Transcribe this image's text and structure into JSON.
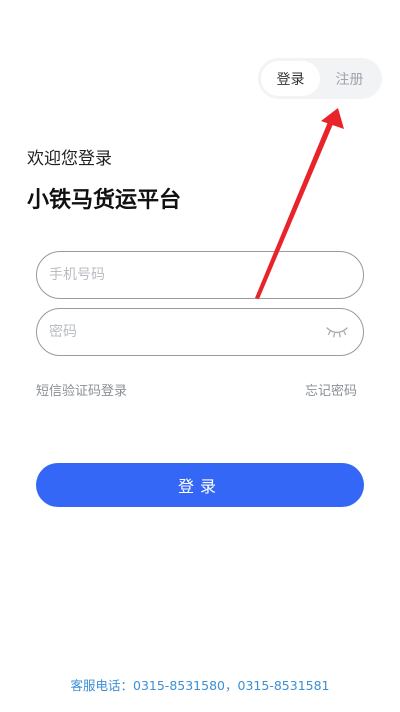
{
  "auth_toggle": {
    "login_label": "登录",
    "register_label": "注册"
  },
  "header": {
    "welcome": "欢迎您登录",
    "brand": "小铁马货运平台"
  },
  "form": {
    "phone_placeholder": "手机号码",
    "password_placeholder": "密码",
    "sms_login_link": "短信验证码登录",
    "forgot_password_link": "忘记密码",
    "submit_label": "登录"
  },
  "footer": {
    "service_label": "客服电话：",
    "phone_1": "0315-8531580",
    "separator": "，",
    "phone_2": "0315-8531581"
  },
  "colors": {
    "primary": "#3567f6",
    "annotation_arrow": "#e8232a",
    "service_text": "#3a8fd8"
  },
  "icons": {
    "password_visibility": "eye-closed-icon"
  }
}
